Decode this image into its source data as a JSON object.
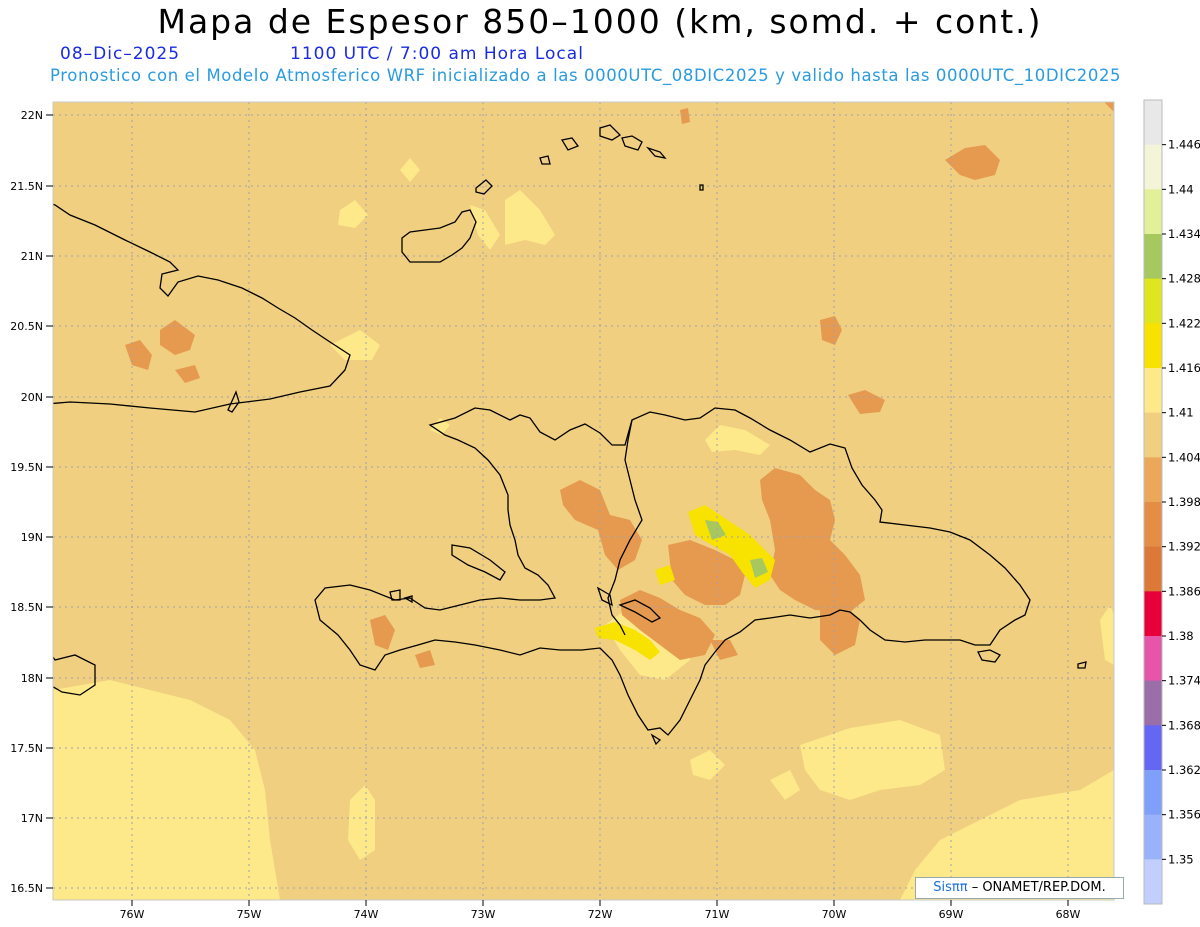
{
  "title": "Mapa de Espesor 850–1000 (km, somd. + cont.)",
  "date": "08–Dic–2025",
  "time": "1100 UTC / 7:00 am Hora Local",
  "forecast": "Pronostico con el Modelo Atmosferico WRF inicializado a las 0000UTC_08DIC2025 y valido hasta las  0000UTC_10DIC2025",
  "credit_brand": "Sisππ",
  "credit_text": " – ONAMET/REP.DOM.",
  "lat_labels": [
    "22N",
    "21.5N",
    "21N",
    "20.5N",
    "20N",
    "19.5N",
    "19N",
    "18.5N",
    "18N",
    "17.5N",
    "17N",
    "16.5N"
  ],
  "lon_labels": [
    "76W",
    "75W",
    "74W",
    "73W",
    "72W",
    "71W",
    "70W",
    "69W",
    "68W"
  ],
  "colorbar": {
    "labels": [
      "1.446",
      "1.44",
      "1.434",
      "1.428",
      "1.422",
      "1.416",
      "1.41",
      "1.404",
      "1.398",
      "1.392",
      "1.386",
      "1.38",
      "1.374",
      "1.368",
      "1.362",
      "1.356",
      "1.35"
    ],
    "colors": [
      "#e8e8e8",
      "#f4f4d8",
      "#e2f09a",
      "#a6c85e",
      "#dfe61e",
      "#f7e200",
      "#fde88a",
      "#f0cf80",
      "#eca85a",
      "#e38e44",
      "#dc7838",
      "#e8003a",
      "#e655a8",
      "#9a6ea8",
      "#6666f4",
      "#7f9ff9",
      "#99b2fa",
      "#c2cefb"
    ]
  },
  "colors": {
    "background_field": "#f0cf80",
    "light_field": "#fde88a",
    "dark_field": "#e59a50",
    "coast": "#000000"
  }
}
